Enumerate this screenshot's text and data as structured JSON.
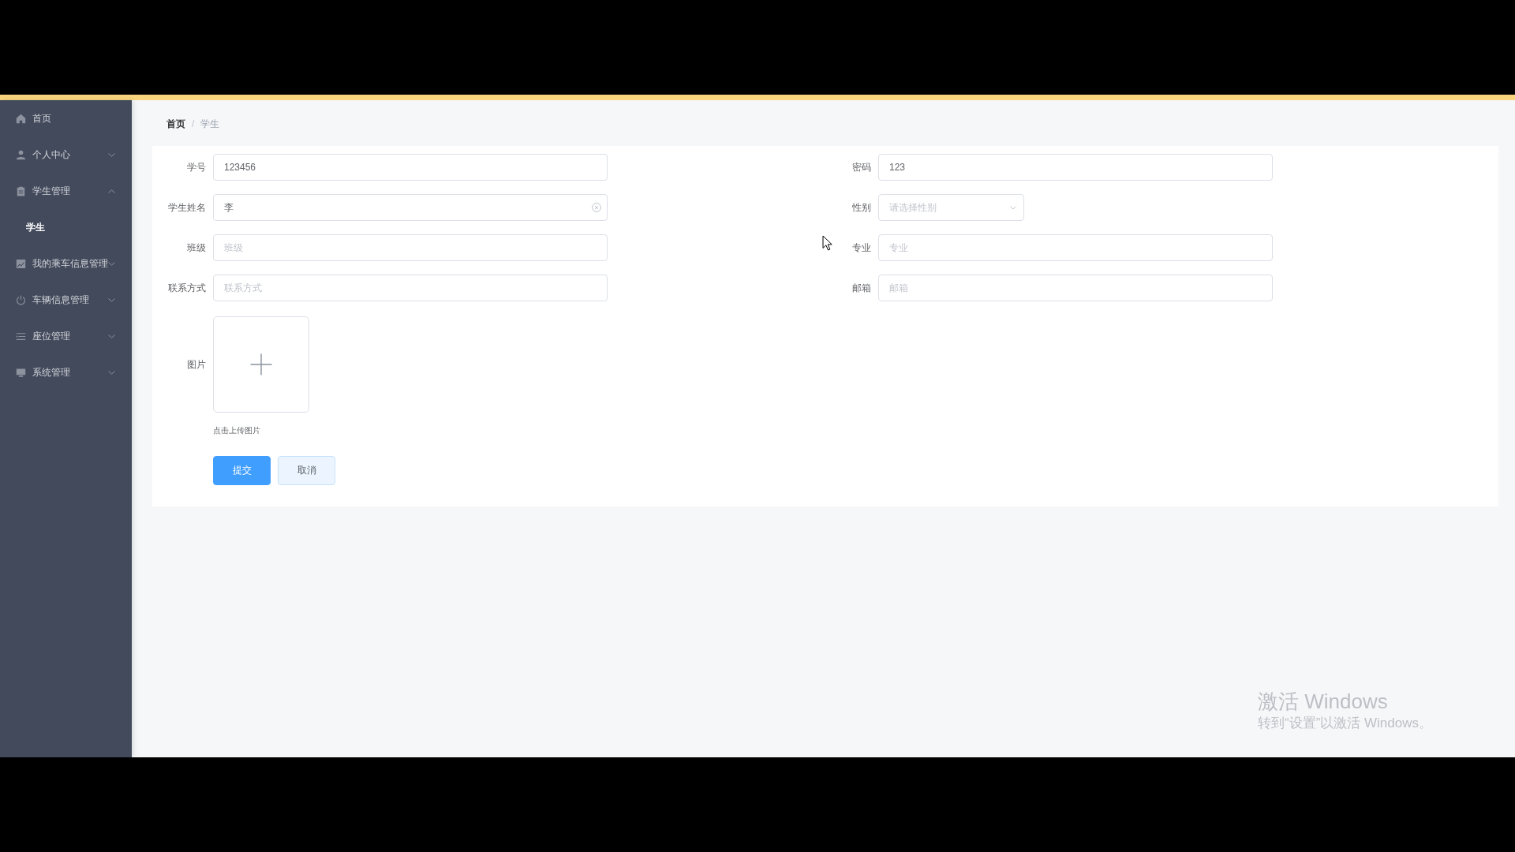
{
  "sidebar": {
    "items": [
      {
        "kind": "item",
        "label": "首页",
        "selected": false
      },
      {
        "kind": "submenu",
        "label": "个人中心",
        "expanded": false
      },
      {
        "kind": "submenu",
        "label": "学生管理",
        "expanded": true,
        "children": [
          {
            "label": "学生",
            "selected": true
          }
        ]
      },
      {
        "kind": "submenu",
        "label": "我的乘车信息管理",
        "expanded": false
      },
      {
        "kind": "submenu",
        "label": "车辆信息管理",
        "expanded": false
      },
      {
        "kind": "submenu",
        "label": "座位管理",
        "expanded": false
      },
      {
        "kind": "submenu",
        "label": "系统管理",
        "expanded": false
      }
    ]
  },
  "breadcrumb": {
    "items": [
      "首页",
      "学生"
    ],
    "separator": "/"
  },
  "form": {
    "fields": [
      {
        "kind": "text",
        "label": "学号",
        "value": "123456",
        "clearable": false
      },
      {
        "kind": "text",
        "label": "密码",
        "value": "123",
        "clearable": false
      },
      {
        "kind": "text",
        "label": "学生姓名",
        "value": "李",
        "clearable": true
      },
      {
        "kind": "select",
        "label": "性别",
        "placeholder": "请选择性别"
      },
      {
        "kind": "text",
        "label": "班级",
        "placeholder": "班级",
        "clearable": false
      },
      {
        "kind": "text",
        "label": "专业",
        "placeholder": "专业",
        "clearable": false
      },
      {
        "kind": "text",
        "label": "联系方式",
        "placeholder": "联系方式",
        "clearable": false
      },
      {
        "kind": "text",
        "label": "邮箱",
        "placeholder": "邮箱",
        "clearable": false
      },
      {
        "kind": "upload",
        "label": "图片",
        "hint": "点击上传图片"
      }
    ],
    "buttons": [
      {
        "kind": "primary",
        "label": "提交"
      },
      {
        "kind": "default",
        "label": "取消"
      }
    ]
  },
  "activation_notice": {
    "title": "激活 Windows",
    "message": "转到“设置”以激活 Windows。"
  }
}
